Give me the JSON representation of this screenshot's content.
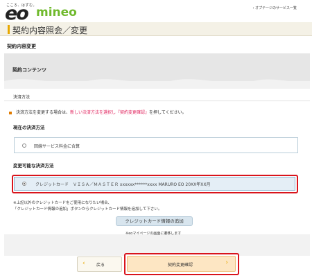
{
  "header": {
    "tagline": "こころ、はずむ。",
    "logo_eo": "eo",
    "logo_mineo": "mineo",
    "options_link": "› オプテージのサービス一覧"
  },
  "page": {
    "title": "契約内容照会／変更",
    "section_heading": "契約内容変更",
    "panel_label": "契約コンテンツ",
    "payment_label": "決済方法"
  },
  "notice": {
    "prefix": "決済方法を変更する場合は、",
    "highlight": "新しい決済方法を選択し『契約変更確認』",
    "suffix": "を押してください。"
  },
  "current": {
    "heading": "現在の決済方法",
    "option": "回線サービス料金に合算"
  },
  "changeable": {
    "heading": "変更可能な決済方法",
    "option": "クレジットカード　ＶＩＳＡ／ＭＡＳＴＥＲ xxxxxx******xxxx MARURO EO 20XX年XX月"
  },
  "notes": {
    "line1": "※上記以外のクレジットカードをご使用になりたい場合、",
    "line2": "「クレジットカード情報の追加」ボタンからクレジットカード情報を追加して下さい。",
    "add_card_button": "クレジットカード情報の追加",
    "mypage_note": "※eoマイページの画面に遷移します"
  },
  "footer": {
    "back_label": "戻る",
    "confirm_label": "契約変更確認"
  },
  "colors": {
    "accent": "#e8a800",
    "highlight_red": "#d9141c",
    "mineo_green": "#6fb92c"
  }
}
